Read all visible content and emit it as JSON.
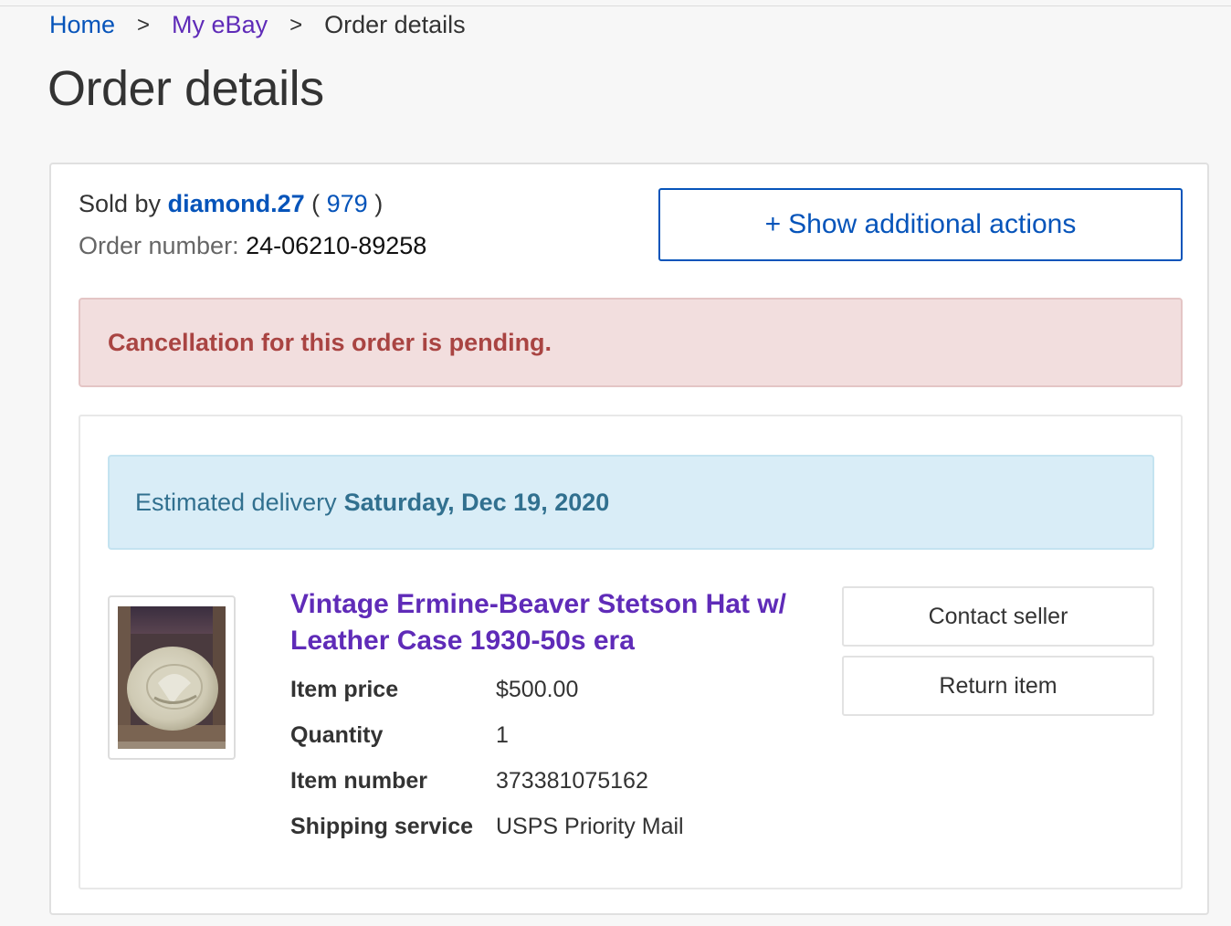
{
  "breadcrumb": {
    "home": "Home",
    "my_ebay": "My eBay",
    "current": "Order details",
    "separator": ">"
  },
  "page_title": "Order details",
  "order": {
    "sold_by_label": "Sold by",
    "seller_name": "diamond.27",
    "feedback_open": "(",
    "feedback_score": "979",
    "feedback_close": ")",
    "order_number_label": "Order number:",
    "order_number": "24-06210-89258",
    "actions_button_plus": "+",
    "actions_button": "Show additional actions"
  },
  "alert": {
    "message": "Cancellation for this order is pending.",
    "color": "#a94442"
  },
  "delivery": {
    "label": "Estimated delivery",
    "date": "Saturday, Dec 19, 2020"
  },
  "item": {
    "title": "Vintage Ermine-Beaver Stetson Hat w/ Leather Case 1930-50s era",
    "details": [
      {
        "label": "Item price",
        "value": "$500.00"
      },
      {
        "label": "Quantity",
        "value": "1"
      },
      {
        "label": "Item number",
        "value": "373381075162"
      },
      {
        "label": "Shipping service",
        "value": "USPS Priority Mail"
      }
    ],
    "thumbnail_alt": "hat-in-case-photo"
  },
  "buttons": {
    "contact_seller": "Contact seller",
    "return_item": "Return item"
  },
  "colors": {
    "link_blue": "#0654ba",
    "visited_purple": "#5f2bb8",
    "info_bg": "#d9edf7",
    "danger_bg": "#f2dede"
  }
}
